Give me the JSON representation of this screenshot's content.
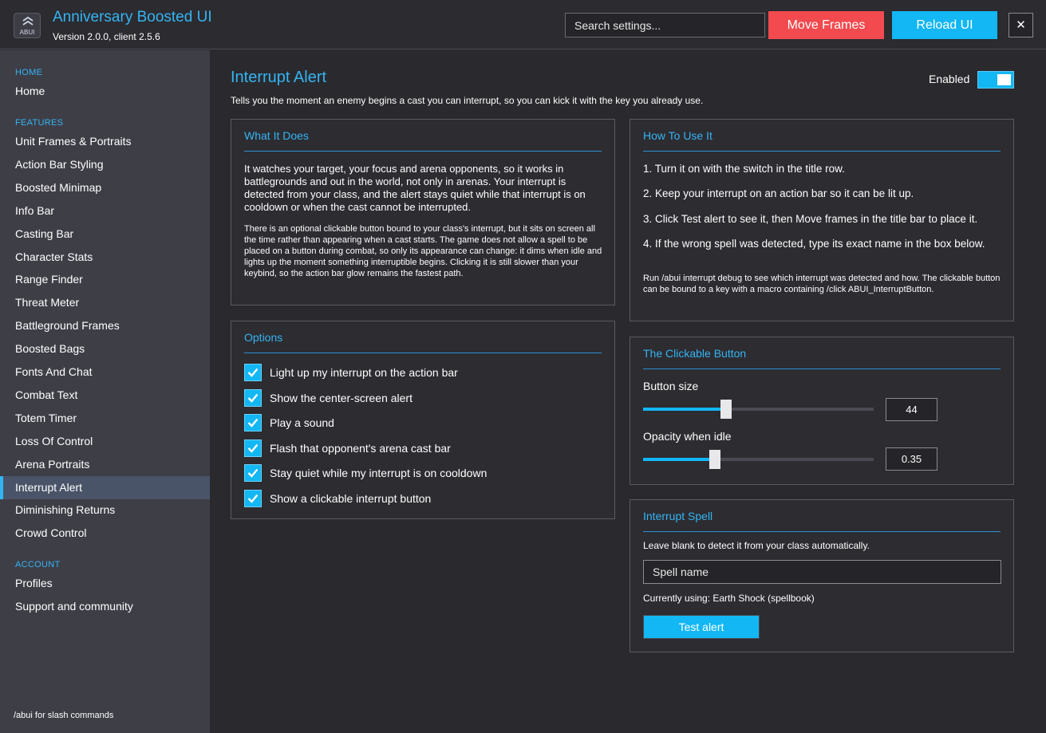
{
  "app": {
    "title": "Anniversary Boosted UI",
    "version": "Version 2.0.0, client 2.5.6",
    "logo_text": "ABUI"
  },
  "header": {
    "search_placeholder": "Search settings...",
    "move_frames_label": "Move Frames",
    "reload_ui_label": "Reload UI",
    "close_label": "✕"
  },
  "sidebar": {
    "home_heading": "HOME",
    "home_items": [
      {
        "label": "Home"
      }
    ],
    "features_heading": "FEATURES",
    "feature_items": [
      {
        "label": "Unit Frames & Portraits"
      },
      {
        "label": "Action Bar Styling"
      },
      {
        "label": "Boosted Minimap"
      },
      {
        "label": "Info Bar"
      },
      {
        "label": "Casting Bar"
      },
      {
        "label": "Character Stats"
      },
      {
        "label": "Range Finder"
      },
      {
        "label": "Threat Meter"
      },
      {
        "label": "Battleground Frames"
      },
      {
        "label": "Boosted Bags"
      },
      {
        "label": "Fonts And Chat"
      },
      {
        "label": "Combat Text"
      },
      {
        "label": "Totem Timer"
      },
      {
        "label": "Loss Of Control"
      },
      {
        "label": "Arena Portraits"
      },
      {
        "label": "Interrupt Alert",
        "active": true
      },
      {
        "label": "Diminishing Returns"
      },
      {
        "label": "Crowd Control"
      }
    ],
    "account_heading": "ACCOUNT",
    "account_items": [
      {
        "label": "Profiles"
      },
      {
        "label": "Support and community"
      }
    ],
    "footer": "/abui for slash commands"
  },
  "main": {
    "title": "Interrupt Alert",
    "description": "Tells you the moment an enemy begins a cast you can interrupt, so you can kick it with the key you already use.",
    "enabled_label": "Enabled",
    "enabled": true,
    "what_it_does": {
      "title": "What It Does",
      "para1": "It watches your target, your focus and arena opponents, so it works in battlegrounds and out in the world, not only in arenas.  Your interrupt is detected from your class, and the alert stays quiet while that interrupt is on cooldown or when the cast cannot be interrupted.",
      "para2": "There is an optional clickable button bound to your class's interrupt, but it sits on screen all the time rather than appearing when a cast starts.  The game does not allow a spell to be placed on a button during combat, so only its appearance can change: it dims when idle and lights up the moment something interruptible begins.  Clicking it is still slower than your keybind, so the action bar glow remains the fastest path."
    },
    "options": {
      "title": "Options",
      "items": [
        {
          "label": "Light up my interrupt on the action bar",
          "checked": true
        },
        {
          "label": "Show the center-screen alert",
          "checked": true
        },
        {
          "label": "Play a sound",
          "checked": true
        },
        {
          "label": "Flash that opponent's arena cast bar",
          "checked": true
        },
        {
          "label": "Stay quiet while my interrupt is on cooldown",
          "checked": true
        },
        {
          "label": "Show a clickable interrupt button",
          "checked": true
        }
      ]
    },
    "how_to_use": {
      "title": "How To Use It",
      "steps": [
        "1.  Turn it on with the switch in the title row.",
        "2.  Keep your interrupt on an action bar so it can be lit up.",
        "3.  Click Test alert to see it, then Move frames in the title bar to place it.",
        "4.  If the wrong spell was detected, type its exact name in the box below."
      ],
      "note": "Run /abui interrupt debug to see which interrupt was detected and how.  The clickable button can be bound to a key with a macro containing /click ABUI_InterruptButton."
    },
    "clickable_button": {
      "title": "The Clickable Button",
      "size_label": "Button size",
      "size_value": "44",
      "size_fraction": 0.36,
      "opacity_label": "Opacity when idle",
      "opacity_value": "0.35",
      "opacity_fraction": 0.31
    },
    "interrupt_spell": {
      "title": "Interrupt Spell",
      "hint": "Leave blank to detect it from your class automatically.",
      "placeholder": "Spell name",
      "current": "Currently using: Earth Shock  (spellbook)",
      "test_label": "Test alert"
    }
  },
  "colors": {
    "accent": "#35b4f2",
    "button_blue": "#12b7f4",
    "button_red": "#f24a4e"
  }
}
